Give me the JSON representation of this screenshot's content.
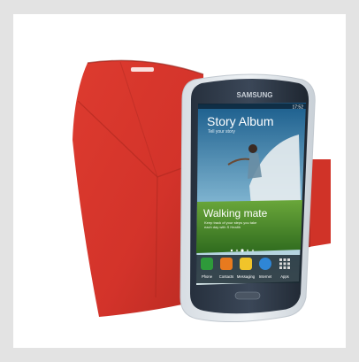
{
  "product": {
    "brand": "SAMSUNG",
    "status_time": "17:52",
    "widgets": {
      "album_title": "Story Album",
      "album_subtitle": "Tell your story",
      "walking_title": "Walking mate",
      "walking_subtitle_1": "Keep track of your steps you take",
      "walking_subtitle_2": "each day with S Health"
    },
    "dock": [
      {
        "label": "Phone",
        "icon": "phone-icon",
        "color": "#2e9a3a"
      },
      {
        "label": "Contacts",
        "icon": "contacts-icon",
        "color": "#e87a1e"
      },
      {
        "label": "Messaging",
        "icon": "messaging-icon",
        "color": "#f1c42a"
      },
      {
        "label": "Internet",
        "icon": "internet-icon",
        "color": "#2f86d6"
      },
      {
        "label": "Apps",
        "icon": "apps-icon",
        "color": "#d9d9d9"
      }
    ],
    "colors": {
      "case_red": "#d7352a",
      "case_red_dark": "#b3261d",
      "background": "#e3e3e3",
      "card": "#ffffff"
    }
  }
}
